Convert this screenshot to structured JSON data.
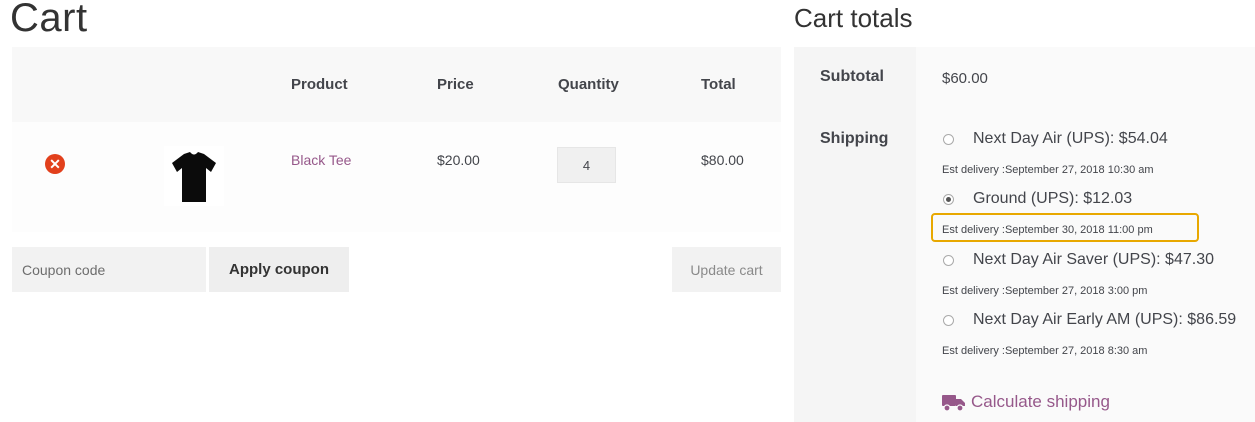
{
  "cart": {
    "title": "Cart",
    "columns": {
      "remove": "",
      "thumbnail": "",
      "product": "Product",
      "price": "Price",
      "quantity": "Quantity",
      "total": "Total"
    },
    "items": [
      {
        "product": "Black Tee",
        "price": "$20.00",
        "quantity": "4",
        "total": "$80.00",
        "remove_icon": "remove-circle-x-icon",
        "thumbnail": "black-tshirt"
      }
    ],
    "coupon": {
      "placeholder": "Coupon code",
      "value": ""
    },
    "apply_coupon_label": "Apply coupon",
    "update_cart_label": "Update cart"
  },
  "totals": {
    "title": "Cart totals",
    "subtotal_label": "Subtotal",
    "subtotal_value": "$60.00",
    "shipping_label": "Shipping",
    "shipping_options": [
      {
        "label": "Next Day Air (UPS): $54.04",
        "est": "Est delivery :September 27, 2018 10:30 am",
        "selected": false
      },
      {
        "label": "Ground (UPS): $12.03",
        "est": "Est delivery :September 30, 2018 11:00 pm",
        "selected": true
      },
      {
        "label": "Next Day Air Saver (UPS): $47.30",
        "est": "Est delivery :September 27, 2018 3:00 pm",
        "selected": false
      },
      {
        "label": "Next Day Air Early AM (UPS): $86.59",
        "est": "Est delivery :September 27, 2018 8:30 am",
        "selected": false
      }
    ],
    "calculate_shipping_label": "Calculate shipping",
    "calculate_icon": "truck-icon"
  },
  "colors": {
    "accent": "#96588a",
    "remove": "#e2401c",
    "highlight": "#e8a800"
  }
}
